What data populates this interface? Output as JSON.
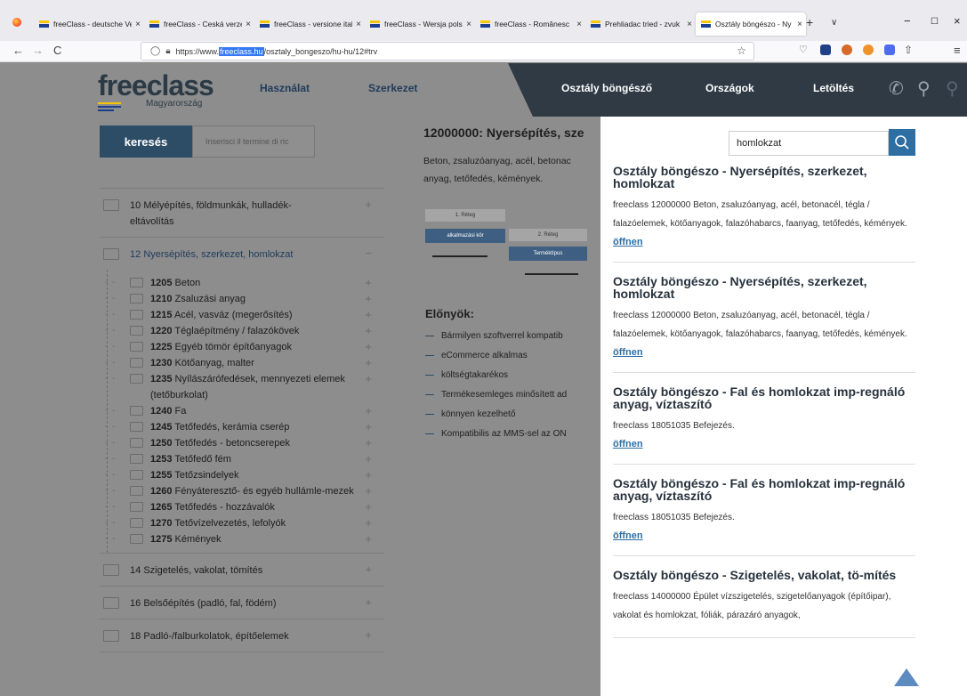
{
  "browser": {
    "tabs": [
      {
        "title": "freeClass - deutsche Ve"
      },
      {
        "title": "freeClass - Ceská verze"
      },
      {
        "title": "freeClass - versione ital"
      },
      {
        "title": "freeClass - Wersja polsl"
      },
      {
        "title": "freeClass - Românesc"
      },
      {
        "title": "Prehliadac tried - zvuk"
      },
      {
        "title": "Osztály böngészo - Ny"
      }
    ],
    "url_prefix": "https://www.",
    "url_highlight": "freeclass.hu",
    "url_suffix": "/osztaly_bongeszo/hu-hu/12#trv"
  },
  "header": {
    "logo": "freeclass",
    "logo_sub": "Magyarország",
    "menu": [
      "Használat",
      "Szerkezet"
    ],
    "dark_menu": [
      "Osztály böngésző",
      "Országok",
      "Letöltés"
    ],
    "colors": {
      "dark": "#2f3a44",
      "accent": "#2d6ea3",
      "logo_yellow": "#f7c600",
      "logo_blue": "#1a3f8f"
    }
  },
  "left": {
    "search_label": "keresés",
    "search_placeholder": "Inserisci il termine di ric",
    "top_categories": [
      {
        "code": "10",
        "label": "Mélyépítés, földmunkák, hulladék-eltávolítás"
      },
      {
        "code": "12",
        "label": "Nyersépítés, szerkezet, homlokzat"
      }
    ],
    "sub_items": [
      {
        "code": "1205",
        "label": "Beton"
      },
      {
        "code": "1210",
        "label": "Zsaluzási anyag"
      },
      {
        "code": "1215",
        "label": "Acél, vasváz (megerősítés)"
      },
      {
        "code": "1220",
        "label": "Téglaépítmény / falazókövek"
      },
      {
        "code": "1225",
        "label": "Egyéb tömör építőanyagok"
      },
      {
        "code": "1230",
        "label": "Kötőanyag, malter"
      },
      {
        "code": "1235",
        "label": "Nyílászárófedések, mennyezeti elemek (tetőburkolat)"
      },
      {
        "code": "1240",
        "label": "Fa"
      },
      {
        "code": "1245",
        "label": "Tetőfedés, kerámia cserép"
      },
      {
        "code": "1250",
        "label": "Tetőfedés - betoncserepek"
      },
      {
        "code": "1253",
        "label": "Tetőfedő fém"
      },
      {
        "code": "1255",
        "label": "Tetőzsindelyek"
      },
      {
        "code": "1260",
        "label": "Fényáteresztő- és egyéb hullámle-mezek"
      },
      {
        "code": "1265",
        "label": "Tetőfedés - hozzávalók"
      },
      {
        "code": "1270",
        "label": "Tetővízelvezetés, lefolyók"
      },
      {
        "code": "1275",
        "label": "Kémények"
      }
    ],
    "bottom_categories": [
      {
        "code": "14",
        "label": "Szigetelés, vakolat, tömítés"
      },
      {
        "code": "16",
        "label": "Belsőépítés (padló, fal, födém)"
      },
      {
        "code": "18",
        "label": "Padló-/falburkolatok, építőelemek"
      }
    ]
  },
  "middle": {
    "title": "12000000: Nyersépítés, sze",
    "desc_lines": [
      "Beton, zsaluzóanyag, acél, betonac",
      "anyag, tetőfedés, kémények."
    ],
    "diagram_labels": [
      "1. Réteg",
      "alkalmazási kör",
      "2. Réteg",
      "Terméktípus"
    ],
    "advantages_title": "Előnyök:",
    "advantages": [
      "Bármilyen szoftverrel kompatib",
      "eCommerce alkalmas",
      "költségtakarékos",
      "Termékesemleges minősített ad",
      "könnyen kezelhető",
      "Kompatibilis az MMS-sel az ON"
    ]
  },
  "overlay": {
    "search_value": "homlokzat",
    "results": [
      {
        "title": "Osztály böngészo - Nyersépítés, szerkezet, homlokzat",
        "desc": "freeclass 12000000 Beton, zsaluzóanyag, acél, betonacél, tégla / falazóelemek, kötőanyagok, falazóhabarcs, faanyag, tetőfedés, kémények.",
        "link": "öffnen"
      },
      {
        "title": "Osztály böngészo - Nyersépítés, szerkezet, homlokzat",
        "desc": "freeclass 12000000 Beton, zsaluzóanyag, acél, betonacél, tégla / falazóelemek, kötőanyagok, falazóhabarcs, faanyag, tetőfedés, kémények.",
        "link": "öffnen"
      },
      {
        "title": "Osztály böngészo - Fal és homlokzat imp-regnáló anyag, víztaszító",
        "desc": "freeclass 18051035 Befejezés.",
        "link": "öffnen"
      },
      {
        "title": "Osztály böngészo - Fal és homlokzat imp-regnáló anyag, víztaszító",
        "desc": "freeclass 18051035 Befejezés.",
        "link": "öffnen"
      },
      {
        "title": "Osztály böngészo - Szigetelés, vakolat, tö-mítés",
        "desc": "freeclass 14000000 Épület vízszigetelés, szigetelőanyagok (építőipar), vakolat és homlokzat, fóliák, párazáró anyagok,",
        "link": ""
      }
    ]
  }
}
